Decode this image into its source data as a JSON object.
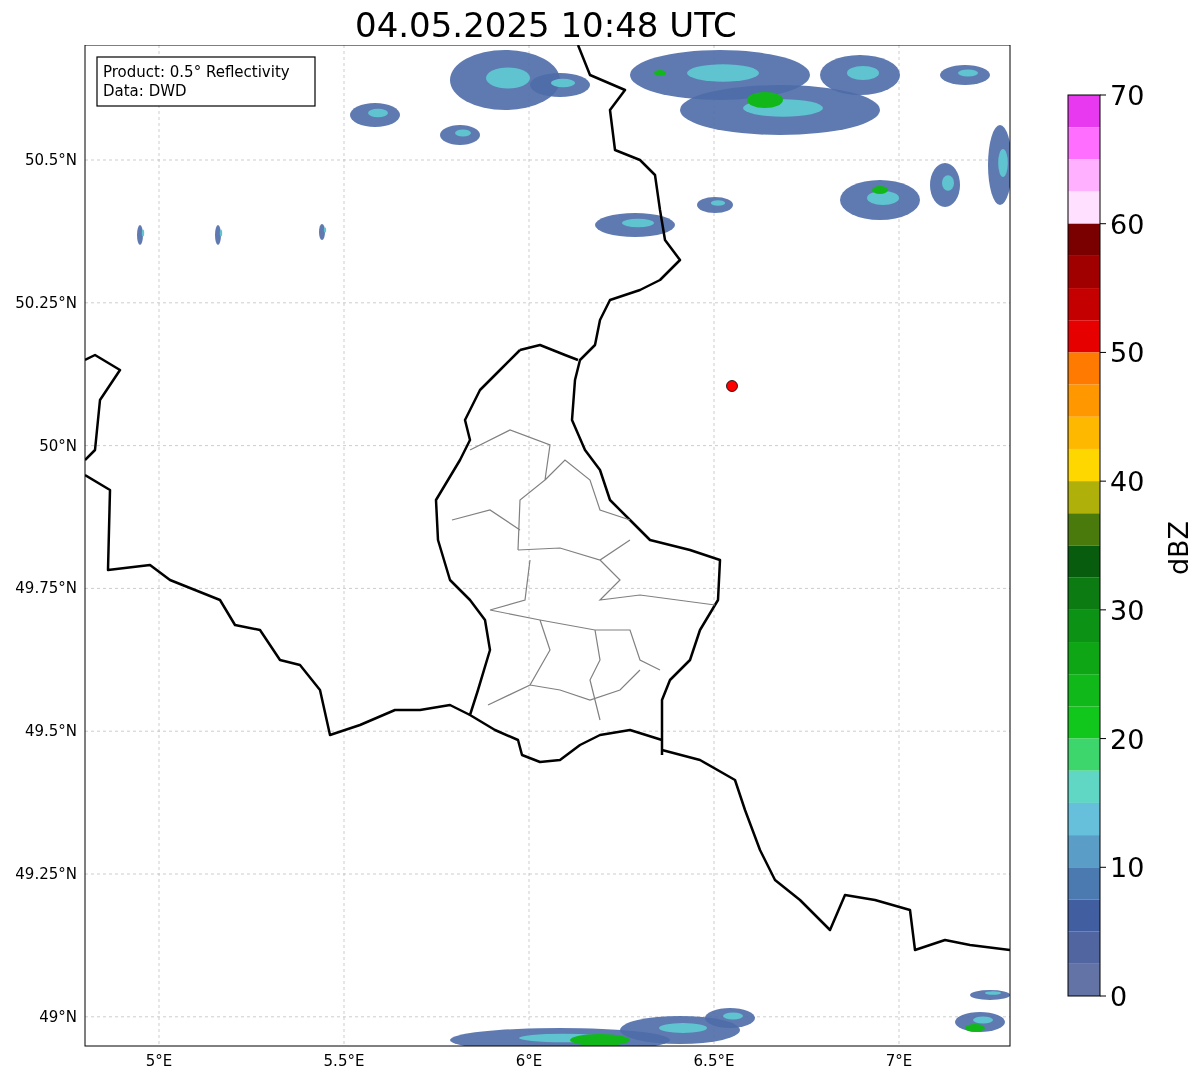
{
  "title": "04.05.2025 10:48 UTC",
  "map": {
    "info_box": [
      "Product: 0.5° Reflectivity",
      "Data: DWD"
    ],
    "lon_ticks": [
      "5°E",
      "5.5°E",
      "6°E",
      "6.5°E",
      "7°E"
    ],
    "lat_ticks": [
      "50.5°N",
      "50.25°N",
      "50°N",
      "49.75°N",
      "49.5°N",
      "49.25°N",
      "49°N"
    ]
  },
  "colorbar": {
    "label": "dBZ",
    "ticks": [
      "70",
      "60",
      "50",
      "40",
      "30",
      "20",
      "10",
      "0"
    ],
    "bins": [
      {
        "color": "#e838f0"
      },
      {
        "color": "#ff6eff"
      },
      {
        "color": "#ffb0ff"
      },
      {
        "color": "#ffe0ff"
      },
      {
        "color": "#7a0000"
      },
      {
        "color": "#a00000"
      },
      {
        "color": "#c40000"
      },
      {
        "color": "#e60000"
      },
      {
        "color": "#ff7a00"
      },
      {
        "color": "#ff9800"
      },
      {
        "color": "#ffb800"
      },
      {
        "color": "#ffd700"
      },
      {
        "color": "#b0b00a"
      },
      {
        "color": "#4a7a0c"
      },
      {
        "color": "#075c0e"
      },
      {
        "color": "#0b7b12"
      },
      {
        "color": "#0c9214"
      },
      {
        "color": "#0ea615"
      },
      {
        "color": "#10b81a"
      },
      {
        "color": "#12c71b"
      },
      {
        "color": "#3dd66d"
      },
      {
        "color": "#5fd7c4"
      },
      {
        "color": "#66c0dc"
      },
      {
        "color": "#5a9ec7"
      },
      {
        "color": "#4a7ab0"
      },
      {
        "color": "#415ea1"
      },
      {
        "color": "#5166a0"
      },
      {
        "color": "#6473a6"
      }
    ]
  }
}
